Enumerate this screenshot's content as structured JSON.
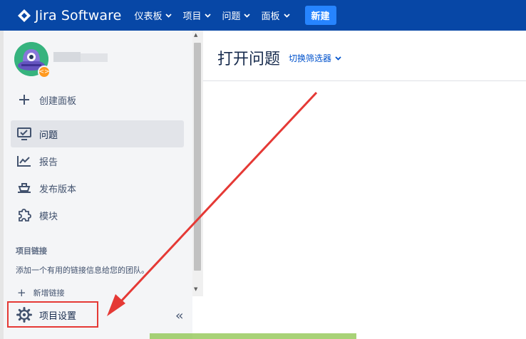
{
  "topnav": {
    "logo_text": "Jira Software",
    "menu": [
      {
        "label": "仪表板"
      },
      {
        "label": "项目"
      },
      {
        "label": "问题"
      },
      {
        "label": "面板"
      }
    ],
    "create_label": "新建",
    "bg_color": "#0747a6",
    "create_color": "#2684ff"
  },
  "sidebar": {
    "create_board": "创建面板",
    "items": [
      {
        "label": "问题",
        "icon": "issues-icon",
        "active": true
      },
      {
        "label": "报告",
        "icon": "reports-icon"
      },
      {
        "label": "发布版本",
        "icon": "releases-icon"
      },
      {
        "label": "模块",
        "icon": "components-icon"
      }
    ],
    "links_title": "项目链接",
    "links_desc": "添加一个有用的链接信息给您的团队。",
    "add_link": "新增链接",
    "settings": "项目设置"
  },
  "main": {
    "title": "打开问题",
    "filter_switch": "切换筛选器"
  },
  "annotation": {
    "color": "#e53935"
  }
}
